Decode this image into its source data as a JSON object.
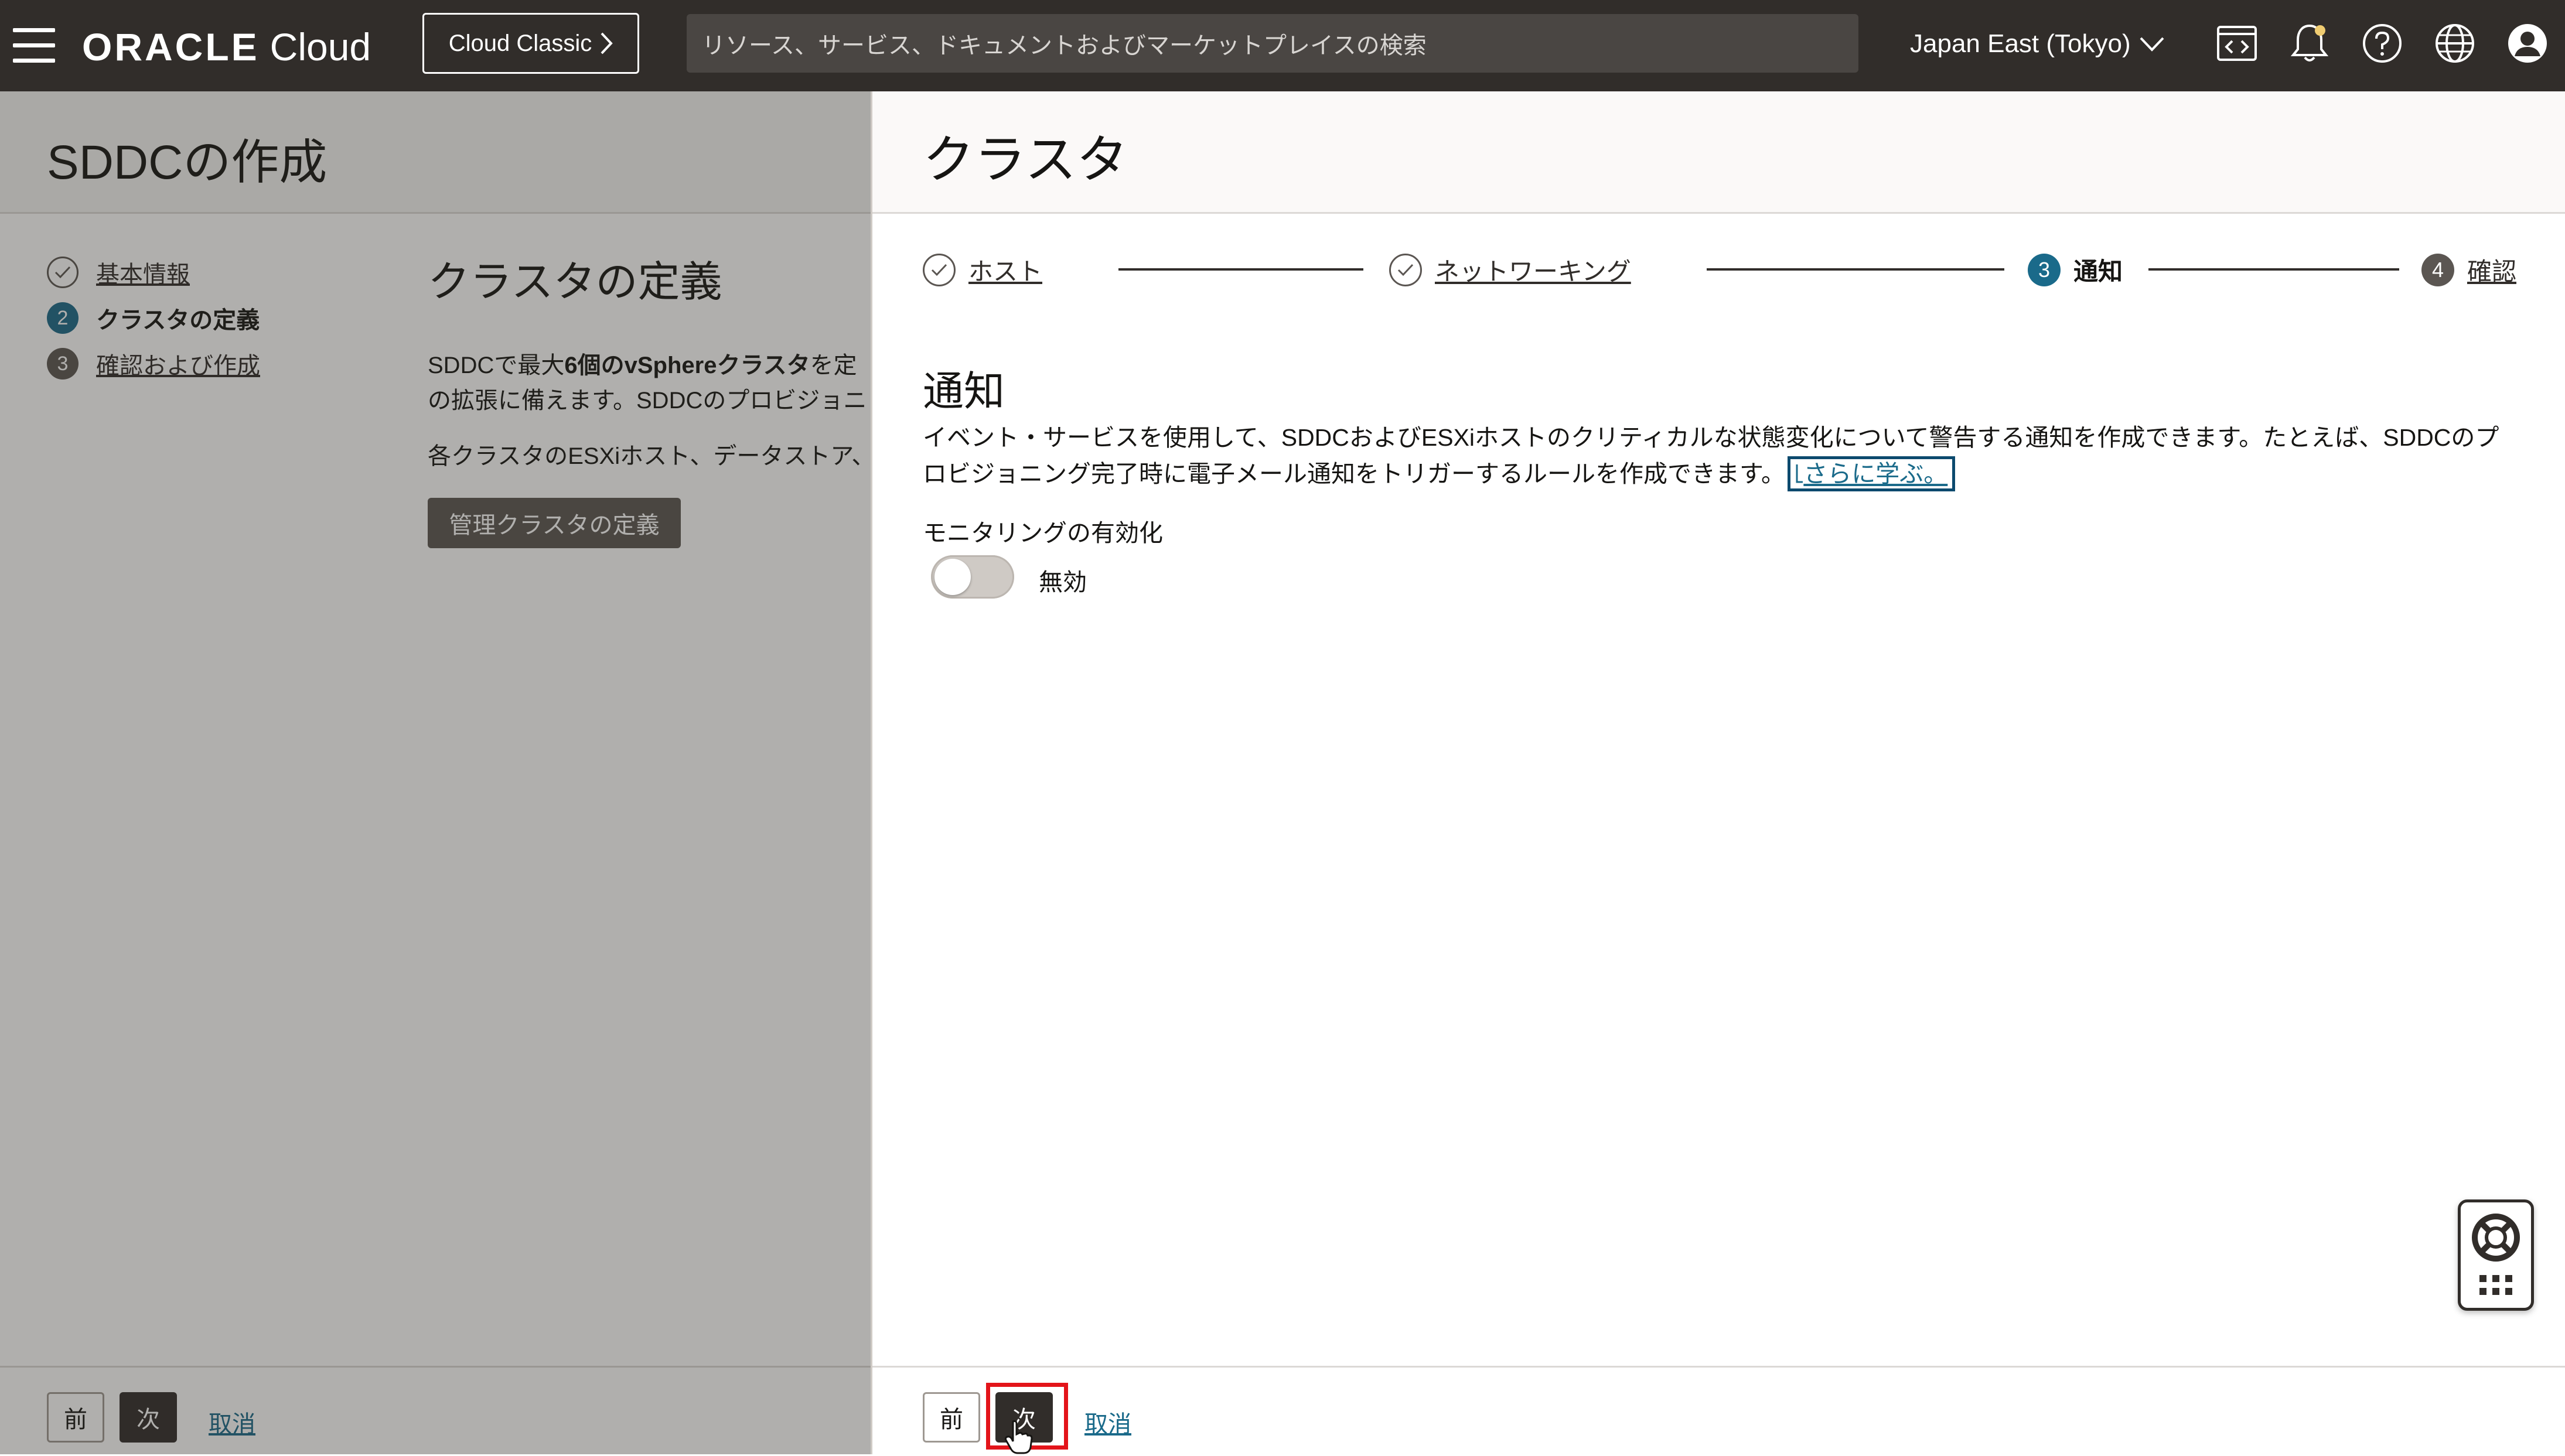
{
  "header": {
    "logo_brand": "ORACLE",
    "logo_product": "Cloud",
    "classic_button": "Cloud Classic",
    "search_placeholder": "リソース、サービス、ドキュメントおよびマーケットプレイスの検索",
    "region": "Japan East (Tokyo)",
    "icons": [
      "menu-icon",
      "developer-tools-icon",
      "notification-bell-icon",
      "help-icon",
      "language-globe-icon",
      "user-profile-icon"
    ]
  },
  "left_page": {
    "title": "SDDCの作成",
    "steps": [
      {
        "num": "1",
        "label": "基本情報",
        "state": "complete"
      },
      {
        "num": "2",
        "label": "クラスタの定義",
        "state": "active"
      },
      {
        "num": "3",
        "label": "確認および作成",
        "state": "pending"
      }
    ],
    "section_title": "クラスタの定義",
    "para1_a": "SDDCで最大",
    "para1_b": "6個のvSphereクラスタ",
    "para1_c": "を定",
    "para1_line2": "の拡張に備えます。SDDCのプロビジョニ",
    "para2": "各クラスタのESXiホスト、データストア、",
    "define_button": "管理クラスタの定義",
    "footer": {
      "prev": "前",
      "next": "次",
      "cancel": "取消"
    }
  },
  "drawer": {
    "title": "クラスタ",
    "train": [
      {
        "num": "1",
        "label": "ホスト",
        "state": "complete"
      },
      {
        "num": "2",
        "label": "ネットワーキング",
        "state": "complete"
      },
      {
        "num": "3",
        "label": "通知",
        "state": "active"
      },
      {
        "num": "4",
        "label": "確認",
        "state": "pending"
      }
    ],
    "section_title": "通知",
    "description": "イベント・サービスを使用して、SDDCおよびESXiホストのクリティカルな状態変化について警告する通知を作成できます。たとえば、SDDCのプロビジョニング完了時に電子メール通知をトリガーするルールを作成できます。",
    "learn_more": "さらに学ぶ。",
    "monitoring_label": "モニタリングの有効化",
    "toggle_state": "無効",
    "toggle_on": false,
    "footer": {
      "prev": "前",
      "next": "次",
      "cancel": "取消"
    }
  },
  "colors": {
    "header_bg": "#312d2a",
    "accent": "#1a6a8a",
    "highlight": "#e3141a"
  }
}
